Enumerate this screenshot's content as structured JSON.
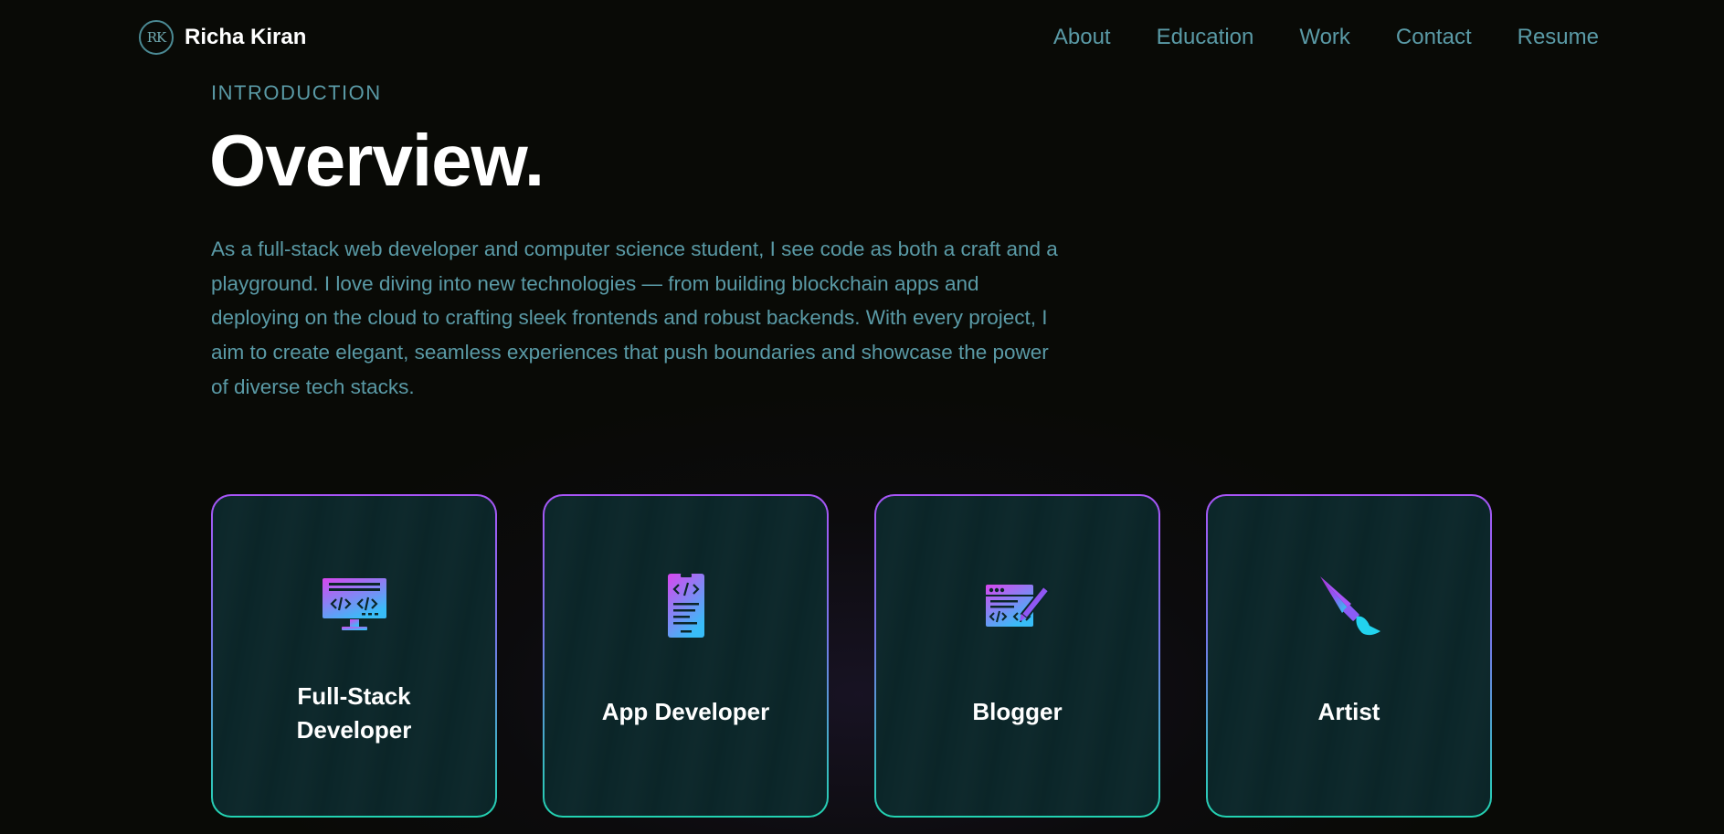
{
  "navbar": {
    "logo_mark": "RK",
    "logo_name": "Richa Kiran",
    "links": [
      {
        "label": "About"
      },
      {
        "label": "Education"
      },
      {
        "label": "Work"
      },
      {
        "label": "Contact"
      },
      {
        "label": "Resume"
      }
    ]
  },
  "intro": {
    "label": "INTRODUCTION",
    "title": "Overview.",
    "text": "As a full-stack web developer and computer science student, I see code as both a craft and a playground. I love diving into new technologies — from building blockchain apps and deploying on the cloud to crafting sleek frontends and robust backends. With every project, I aim to create elegant, seamless experiences that push boundaries and showcase the power of diverse tech stacks."
  },
  "cards": [
    {
      "label": "Full-Stack Developer",
      "icon": "monitor-code-icon"
    },
    {
      "label": "App Developer",
      "icon": "mobile-code-icon"
    },
    {
      "label": "Blogger",
      "icon": "blog-writing-icon"
    },
    {
      "label": "Artist",
      "icon": "paintbrush-icon"
    }
  ],
  "colors": {
    "background": "#090a06",
    "accent_text": "#5a9aa6",
    "card_background": "#0b2629",
    "border_top": "#a855f7",
    "border_bottom": "#22d3b1",
    "icon_gradient_start": "#d946ef",
    "icon_gradient_end": "#38bdf8"
  }
}
